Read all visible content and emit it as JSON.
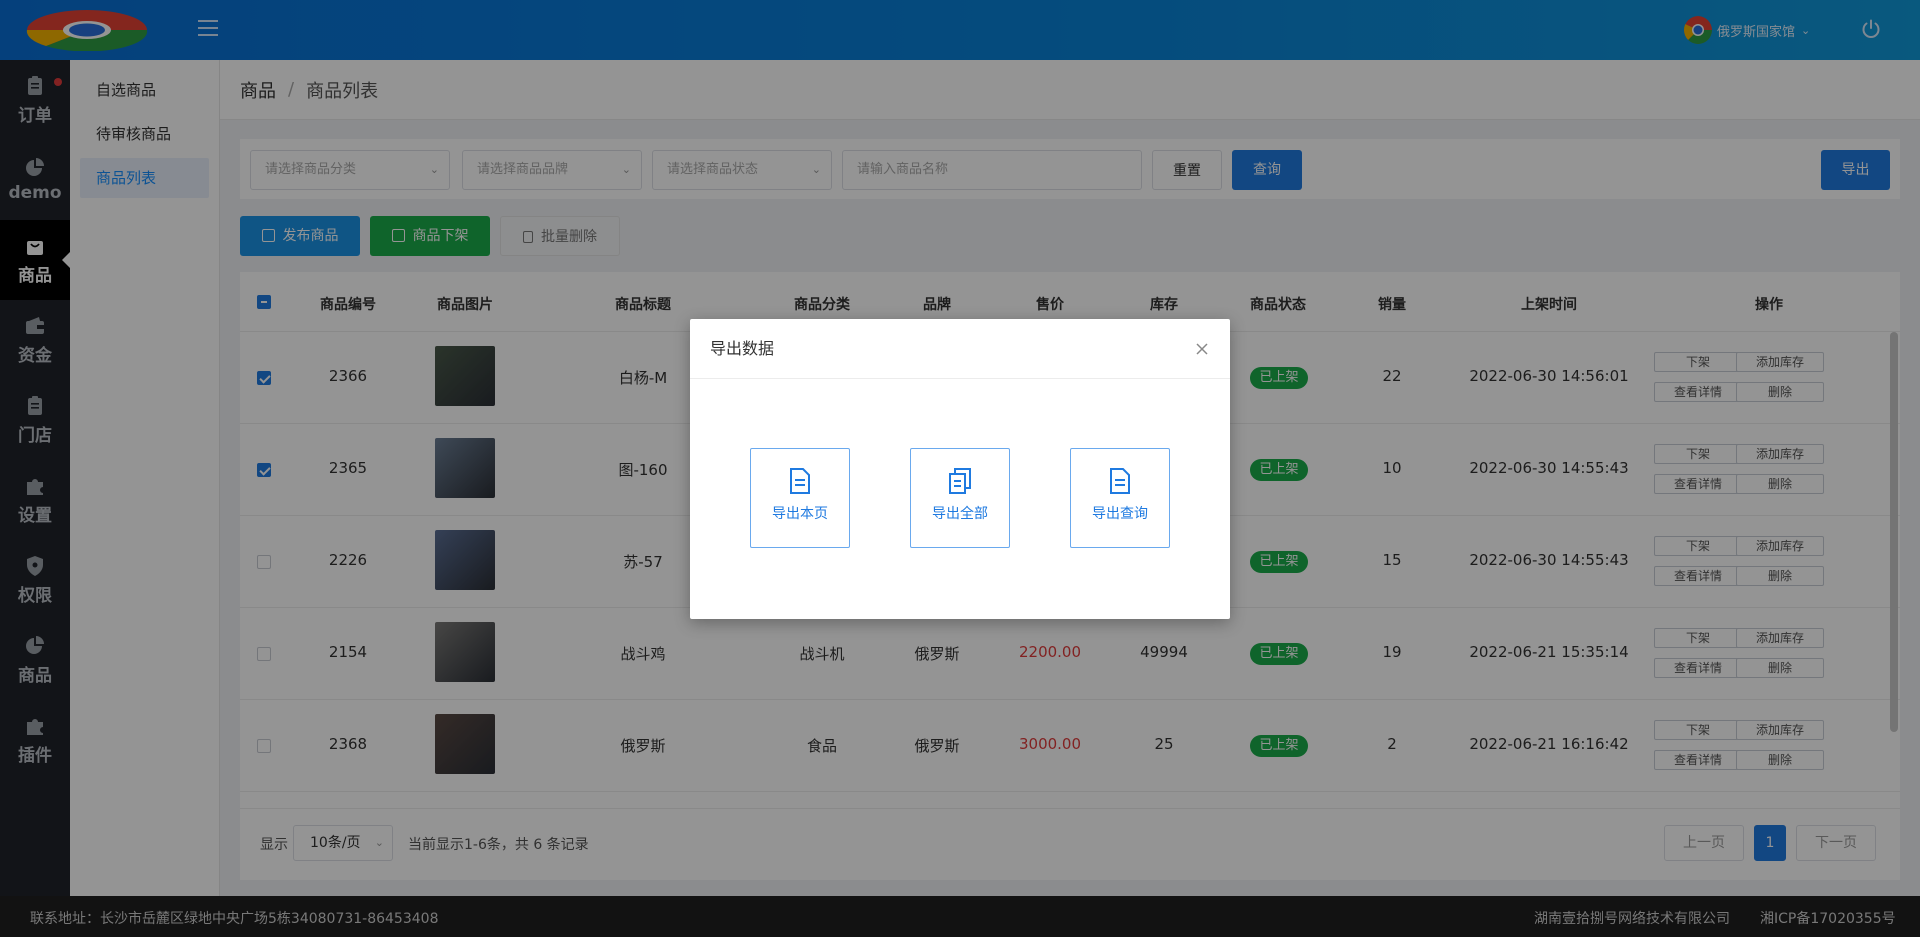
{
  "header": {
    "user_name": "俄罗斯国家馆",
    "colors": {
      "topbar": "#0a7ad8",
      "primary": "#1f7ae0",
      "success": "#1aad4b",
      "danger": "#e03c3c"
    }
  },
  "sidebar": {
    "items": [
      {
        "label": "订单",
        "icon": "clipboard-icon",
        "badge": true
      },
      {
        "label": "demo",
        "icon": "pie-chart-icon"
      },
      {
        "label": "商品",
        "icon": "shopping-bag-icon",
        "active": true
      },
      {
        "label": "资金",
        "icon": "wallet-icon"
      },
      {
        "label": "门店",
        "icon": "clipboard-icon"
      },
      {
        "label": "设置",
        "icon": "puzzle-icon"
      },
      {
        "label": "权限",
        "icon": "shield-icon"
      },
      {
        "label": "商品",
        "icon": "pie-chart-icon"
      },
      {
        "label": "插件",
        "icon": "puzzle-icon"
      }
    ]
  },
  "subnav": {
    "items": [
      {
        "label": "自选商品"
      },
      {
        "label": "待审核商品"
      },
      {
        "label": "商品列表",
        "active": true
      }
    ]
  },
  "breadcrumb": {
    "root": "商品",
    "sep": "/",
    "current": "商品列表"
  },
  "filters": {
    "category_placeholder": "请选择商品分类",
    "brand_placeholder": "请选择商品品牌",
    "status_placeholder": "请选择商品状态",
    "name_placeholder": "请输入商品名称",
    "reset_label": "重置",
    "query_label": "查询",
    "export_label": "导出"
  },
  "actions": {
    "publish_label": "发布商品",
    "offshelf_label": "商品下架",
    "batch_delete_label": "批量删除"
  },
  "table": {
    "headers": {
      "id": "商品编号",
      "image": "商品图片",
      "title": "商品标题",
      "category": "商品分类",
      "brand": "品牌",
      "price": "售价",
      "stock": "库存",
      "status": "商品状态",
      "sales": "销量",
      "time": "上架时间",
      "ops": "操作"
    },
    "op_labels": {
      "offshelf": "下架",
      "add_stock": "添加库存",
      "detail": "查看详情",
      "delete": "删除"
    },
    "rows": [
      {
        "checked": true,
        "id": "2366",
        "title": "白杨-M",
        "category": "",
        "brand": "",
        "price": "",
        "stock": "",
        "status": "已上架",
        "sales": "22",
        "time": "2022-06-30 14:56:01",
        "thumb": "#4a5a4a"
      },
      {
        "checked": true,
        "id": "2365",
        "title": "图-160",
        "category": "",
        "brand": "",
        "price": "",
        "stock": "",
        "status": "已上架",
        "sales": "10",
        "time": "2022-06-30 14:55:43",
        "thumb": "#6c7f96"
      },
      {
        "checked": false,
        "id": "2226",
        "title": "苏-57",
        "category": "",
        "brand": "",
        "price": "",
        "stock": "",
        "status": "已上架",
        "sales": "15",
        "time": "2022-06-30 14:55:43",
        "thumb": "#5b6f95"
      },
      {
        "checked": false,
        "id": "2154",
        "title": "战斗鸡",
        "category": "战斗机",
        "brand": "俄罗斯",
        "price": "2200.00",
        "stock": "49994",
        "status": "已上架",
        "sales": "19",
        "time": "2022-06-21 15:35:14",
        "thumb": "#7b7a78"
      },
      {
        "checked": false,
        "id": "2368",
        "title": "俄罗斯",
        "category": "食品",
        "brand": "俄罗斯",
        "price": "3000.00",
        "stock": "25",
        "status": "已上架",
        "sales": "2",
        "time": "2022-06-21 16:16:42",
        "thumb": "#5a4a44"
      }
    ]
  },
  "pagination": {
    "show_label": "显示",
    "page_size": "10条/页",
    "summary": "当前显示1-6条，共 6 条记录",
    "prev_label": "上一页",
    "current_page": "1",
    "next_label": "下一页"
  },
  "footer": {
    "address": "联系地址：长沙市岳麓区绿地中央广场5栋34080731-86453408",
    "company": "湖南壹拾捌号网络技术有限公司",
    "icp": "湘ICP备17020355号"
  },
  "modal": {
    "title": "导出数据",
    "options": [
      {
        "label": "导出本页",
        "icon": "document-icon"
      },
      {
        "label": "导出全部",
        "icon": "documents-icon"
      },
      {
        "label": "导出查询",
        "icon": "document-icon"
      }
    ]
  }
}
